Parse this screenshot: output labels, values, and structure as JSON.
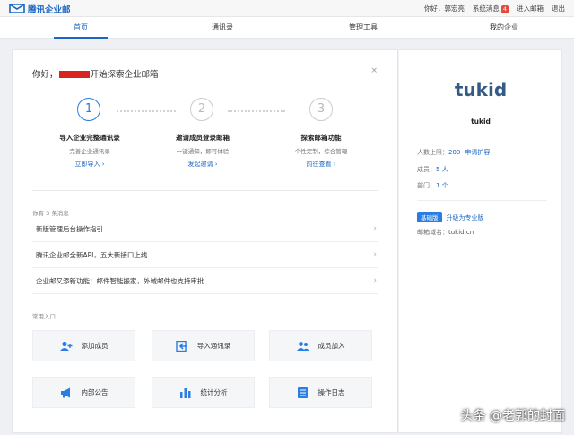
{
  "topbar": {
    "logo_text": "腾讯企业邮",
    "greeting": "你好，郭宏亮",
    "system_msg_label": "系统消息",
    "system_msg_count": "4",
    "enter_mail_label": "进入邮箱",
    "logout_label": "退出"
  },
  "nav": {
    "tabs": [
      {
        "label": "首页",
        "active": true
      },
      {
        "label": "通讯录",
        "active": false
      },
      {
        "label": "管理工具",
        "active": false
      },
      {
        "label": "我的企业",
        "active": false
      }
    ]
  },
  "main": {
    "greeting_prefix": "你好，",
    "greeting_suffix": "开始探索企业邮箱",
    "close_symbol": "×",
    "steps": [
      {
        "number": "1",
        "title": "导入企业完整通讯录",
        "desc": "完善企业通讯录",
        "link": "立即导入 ›"
      },
      {
        "number": "2",
        "title": "邀请成员登录邮箱",
        "desc": "一键通知，即可体验",
        "link": "发起邀请 ›"
      },
      {
        "number": "3",
        "title": "探索邮箱功能",
        "desc": "个性定制，综合管理",
        "link": "前往查看 ›"
      }
    ],
    "messages_label": "你有 3 条消息",
    "messages": [
      {
        "text": "新版管理后台操作指引",
        "chevron": "›"
      },
      {
        "text": "腾讯企业邮全新API，五大新接口上线",
        "chevron": "›"
      },
      {
        "text": "企业邮又添新功能：邮件智能搬家，外域邮件也支持审批",
        "chevron": "›"
      }
    ],
    "shortcuts_label": "常用入口",
    "shortcuts": [
      {
        "label": "添加成员",
        "icon": "add-user-icon"
      },
      {
        "label": "导入通讯录",
        "icon": "import-contacts-icon"
      },
      {
        "label": "成员加入",
        "icon": "members-join-icon"
      },
      {
        "label": "内部公告",
        "icon": "megaphone-icon"
      },
      {
        "label": "统计分析",
        "icon": "bar-chart-icon"
      },
      {
        "label": "操作日志",
        "icon": "log-list-icon"
      }
    ]
  },
  "side": {
    "brand": "tukid",
    "company_name": "tukid",
    "member_limit_label": "人数上限：",
    "member_limit_value": "200",
    "expand_link": "申请扩容",
    "members_label": "成员：",
    "members_value": "5 人",
    "departments_label": "部门：",
    "departments_value": "1 个",
    "plan_tag": "基础版",
    "upgrade_link": "升级为专业版",
    "domain_label": "邮箱域名：",
    "domain_value": "tukid.cn"
  },
  "watermark": "头条 @老郭的封面",
  "colors": {
    "accent": "#1a66c2",
    "brand": "#345a86",
    "badge": "#e04a3f",
    "redaction": "#d8231e"
  }
}
